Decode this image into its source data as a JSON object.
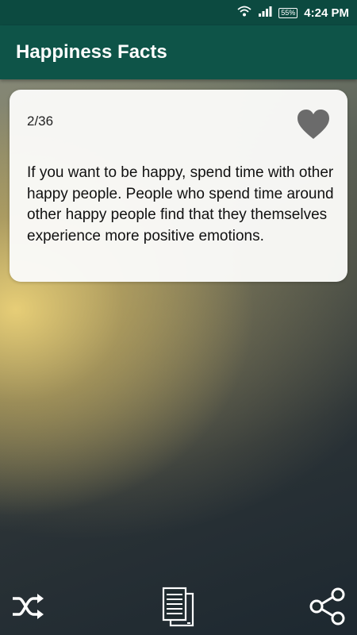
{
  "status_bar": {
    "time": "4:24 PM",
    "battery": "55%",
    "icons": [
      "wifi-icon",
      "signal-icon",
      "battery-icon"
    ]
  },
  "app_bar": {
    "title": "Happiness Facts"
  },
  "fact_card": {
    "counter": "2/36",
    "text": "If you want to be happy, spend time with other happy people. People who spend time around other happy people find that they themselves experience more positive emotions.",
    "favorite_icon": "heart-icon"
  },
  "bottom_bar": {
    "buttons": [
      "shuffle-icon",
      "fact-list-icon",
      "share-icon"
    ]
  },
  "colors": {
    "status_bar": "#0c4a40",
    "app_bar": "#0e5448",
    "heart": "#6b6b6b"
  }
}
